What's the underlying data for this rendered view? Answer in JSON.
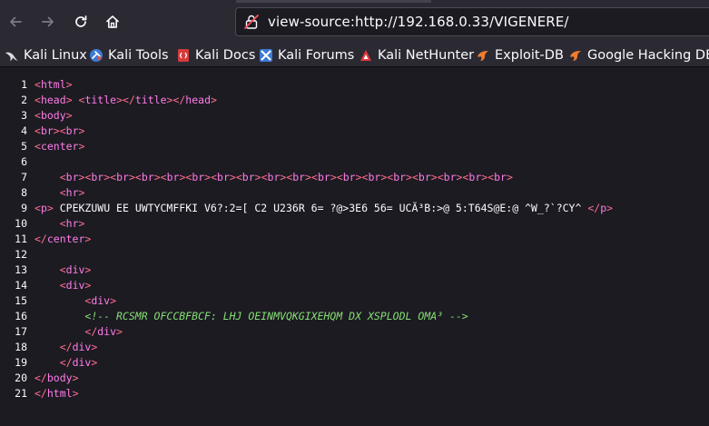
{
  "toolbar": {
    "back_icon": "arrow-left-icon",
    "forward_icon": "arrow-right-icon",
    "reload_icon": "reload-icon",
    "home_icon": "home-icon",
    "url": "view-source:http://192.168.0.33/VIGENERE/",
    "url_icon": "insecure-lock-icon"
  },
  "bookmarks": [
    {
      "label": "Kali Linux",
      "icon": "kali-dragon-icon"
    },
    {
      "label": "Kali Tools",
      "icon": "kali-tools-icon"
    },
    {
      "label": "Kali Docs",
      "icon": "kali-docs-icon"
    },
    {
      "label": "Kali Forums",
      "icon": "kali-forums-icon"
    },
    {
      "label": "Kali NetHunter",
      "icon": "kali-nethunter-icon"
    },
    {
      "label": "Exploit-DB",
      "icon": "exploit-db-icon"
    },
    {
      "label": "Google Hacking DB",
      "icon": "ghdb-icon"
    }
  ],
  "source": {
    "lines": [
      {
        "n": "1",
        "text": "<html>"
      },
      {
        "n": "2",
        "text": "<head> <title></title></head>"
      },
      {
        "n": "3",
        "text": "<body>"
      },
      {
        "n": "4",
        "text": "<br><br>"
      },
      {
        "n": "5",
        "text": "<center>"
      },
      {
        "n": "6",
        "text": ""
      },
      {
        "n": "7",
        "text": "    <br><br><br><br><br><br><br><br><br><br><br><br><br><br><br><br><br><br>"
      },
      {
        "n": "8",
        "text": "    <hr>"
      },
      {
        "n": "9",
        "text": "<p> CPEKZUWU EE UWTYCMFFKI V6?:2=[ C2 U236R 6= ?@>3E6 56= UCÃ³B:>@ 5:T64S@E:@ ^W_?`?CY^ </p>"
      },
      {
        "n": "10",
        "text": "    <hr>"
      },
      {
        "n": "11",
        "text": "</center>"
      },
      {
        "n": "12",
        "text": ""
      },
      {
        "n": "13",
        "text": "    <div>"
      },
      {
        "n": "14",
        "text": "    <div>"
      },
      {
        "n": "15",
        "text": "        <div>"
      },
      {
        "n": "16",
        "text": "        <!-- RCSMR OFCCBFBCF: LHJ OEINMVQKGIXEHQM DX XSPLODL OMA­³ -->"
      },
      {
        "n": "17",
        "text": "        </div>"
      },
      {
        "n": "18",
        "text": "    </div>"
      },
      {
        "n": "19",
        "text": "    </div>"
      },
      {
        "n": "20",
        "text": "</body>"
      },
      {
        "n": "21",
        "text": "</html>"
      }
    ]
  }
}
